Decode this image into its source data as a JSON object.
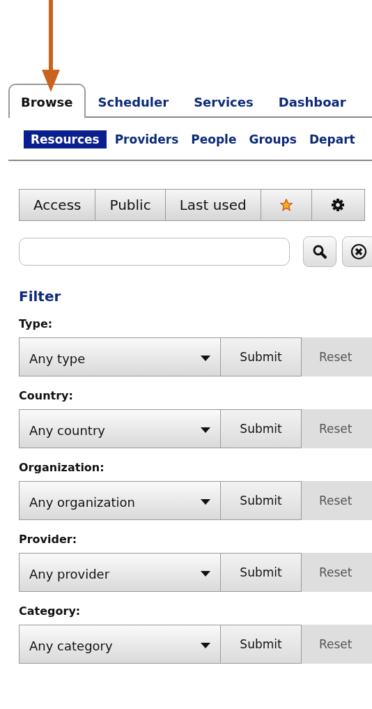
{
  "tabs": [
    {
      "label": "Browse",
      "selected": true
    },
    {
      "label": "Scheduler",
      "selected": false
    },
    {
      "label": "Services",
      "selected": false
    },
    {
      "label": "Dashboar",
      "selected": false
    }
  ],
  "subtabs": [
    {
      "label": "Resources",
      "selected": true
    },
    {
      "label": "Providers",
      "selected": false
    },
    {
      "label": "People",
      "selected": false
    },
    {
      "label": "Groups",
      "selected": false
    },
    {
      "label": "Depart",
      "selected": false
    }
  ],
  "toolbar": [
    {
      "kind": "text",
      "label": "Access"
    },
    {
      "kind": "text",
      "label": "Public"
    },
    {
      "kind": "text",
      "label": "Last used"
    },
    {
      "kind": "star"
    },
    {
      "kind": "gear"
    }
  ],
  "filter": {
    "title": "Filter",
    "groups": [
      {
        "label": "Type:",
        "value": "Any type",
        "submit": "Submit",
        "reset": "Reset",
        "reset_disabled": true
      },
      {
        "label": "Country:",
        "value": "Any country",
        "submit": "Submit",
        "reset": "Reset",
        "reset_disabled": true
      },
      {
        "label": "Organization:",
        "value": "Any organization",
        "submit": "Submit",
        "reset": "Reset",
        "reset_disabled": true
      },
      {
        "label": "Provider:",
        "value": "Any provider",
        "submit": "Submit",
        "reset": "Reset",
        "reset_disabled": true
      },
      {
        "label": "Category:",
        "value": "Any category",
        "submit": "Submit",
        "reset": "Reset",
        "reset_disabled": true
      }
    ]
  }
}
